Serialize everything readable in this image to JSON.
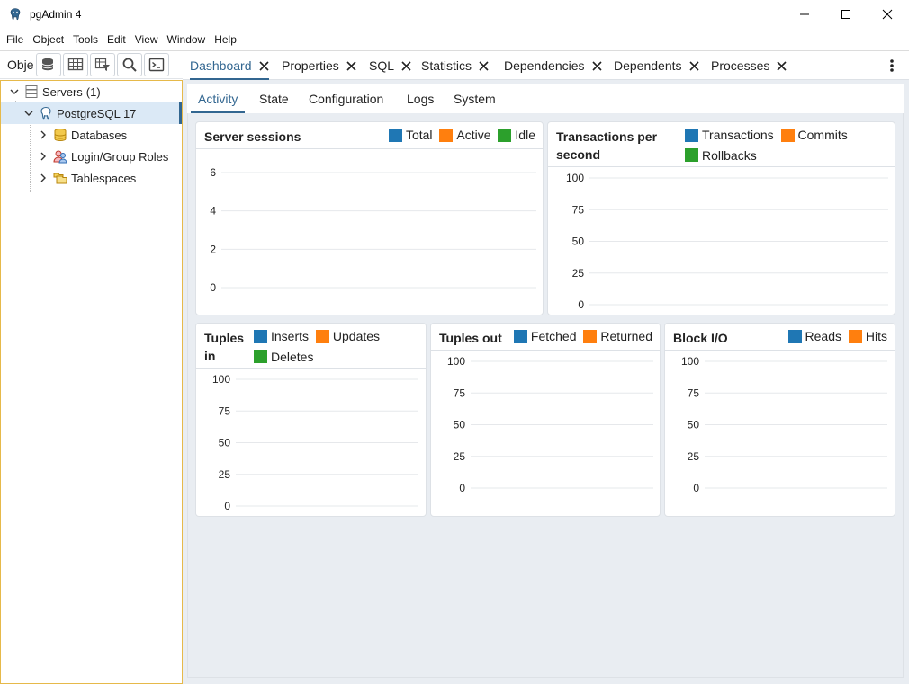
{
  "app": {
    "title": "pgAdmin 4"
  },
  "menu": [
    "File",
    "Object",
    "Tools",
    "Edit",
    "View",
    "Window",
    "Help"
  ],
  "left_panel": {
    "label": "Object Explorer"
  },
  "tree": {
    "servers": "Servers",
    "servers_count": "(1)",
    "server": "PostgreSQL 17",
    "databases": "Databases",
    "roles": "Login/Group Roles",
    "tablespaces": "Tablespaces"
  },
  "tabs": [
    "Dashboard",
    "Properties",
    "SQL",
    "Statistics",
    "Dependencies",
    "Dependents",
    "Processes"
  ],
  "subtabs": [
    "Activity",
    "State",
    "Configuration",
    "Logs",
    "System"
  ],
  "colors": {
    "blue": "#1f77b4",
    "orange": "#ff7f0e",
    "green": "#2ca02c",
    "accent": "#326690"
  },
  "chart_data": [
    {
      "type": "line",
      "title": "Server sessions",
      "series": [
        {
          "name": "Total",
          "values": []
        },
        {
          "name": "Active",
          "values": []
        },
        {
          "name": "Idle",
          "values": []
        }
      ],
      "ylim": [
        0,
        6
      ],
      "yticks": [
        "6",
        "4",
        "2",
        "0"
      ],
      "grid": true
    },
    {
      "type": "line",
      "title": "Transactions per second",
      "series": [
        {
          "name": "Transactions",
          "values": []
        },
        {
          "name": "Commits",
          "values": []
        },
        {
          "name": "Rollbacks",
          "values": []
        }
      ],
      "ylim": [
        0,
        100
      ],
      "yticks": [
        "100",
        "75",
        "50",
        "25",
        "0"
      ],
      "grid": true
    },
    {
      "type": "line",
      "title": "Tuples in",
      "series": [
        {
          "name": "Inserts",
          "values": []
        },
        {
          "name": "Updates",
          "values": []
        },
        {
          "name": "Deletes",
          "values": []
        }
      ],
      "ylim": [
        0,
        100
      ],
      "yticks": [
        "100",
        "75",
        "50",
        "25",
        "0"
      ],
      "grid": true
    },
    {
      "type": "line",
      "title": "Tuples out",
      "series": [
        {
          "name": "Fetched",
          "values": []
        },
        {
          "name": "Returned",
          "values": []
        }
      ],
      "ylim": [
        0,
        100
      ],
      "yticks": [
        "100",
        "75",
        "50",
        "25",
        "0"
      ],
      "grid": true
    },
    {
      "type": "line",
      "title": "Block I/O",
      "series": [
        {
          "name": "Reads",
          "values": []
        },
        {
          "name": "Hits",
          "values": []
        }
      ],
      "ylim": [
        0,
        100
      ],
      "yticks": [
        "100",
        "75",
        "50",
        "25",
        "0"
      ],
      "grid": true
    }
  ]
}
